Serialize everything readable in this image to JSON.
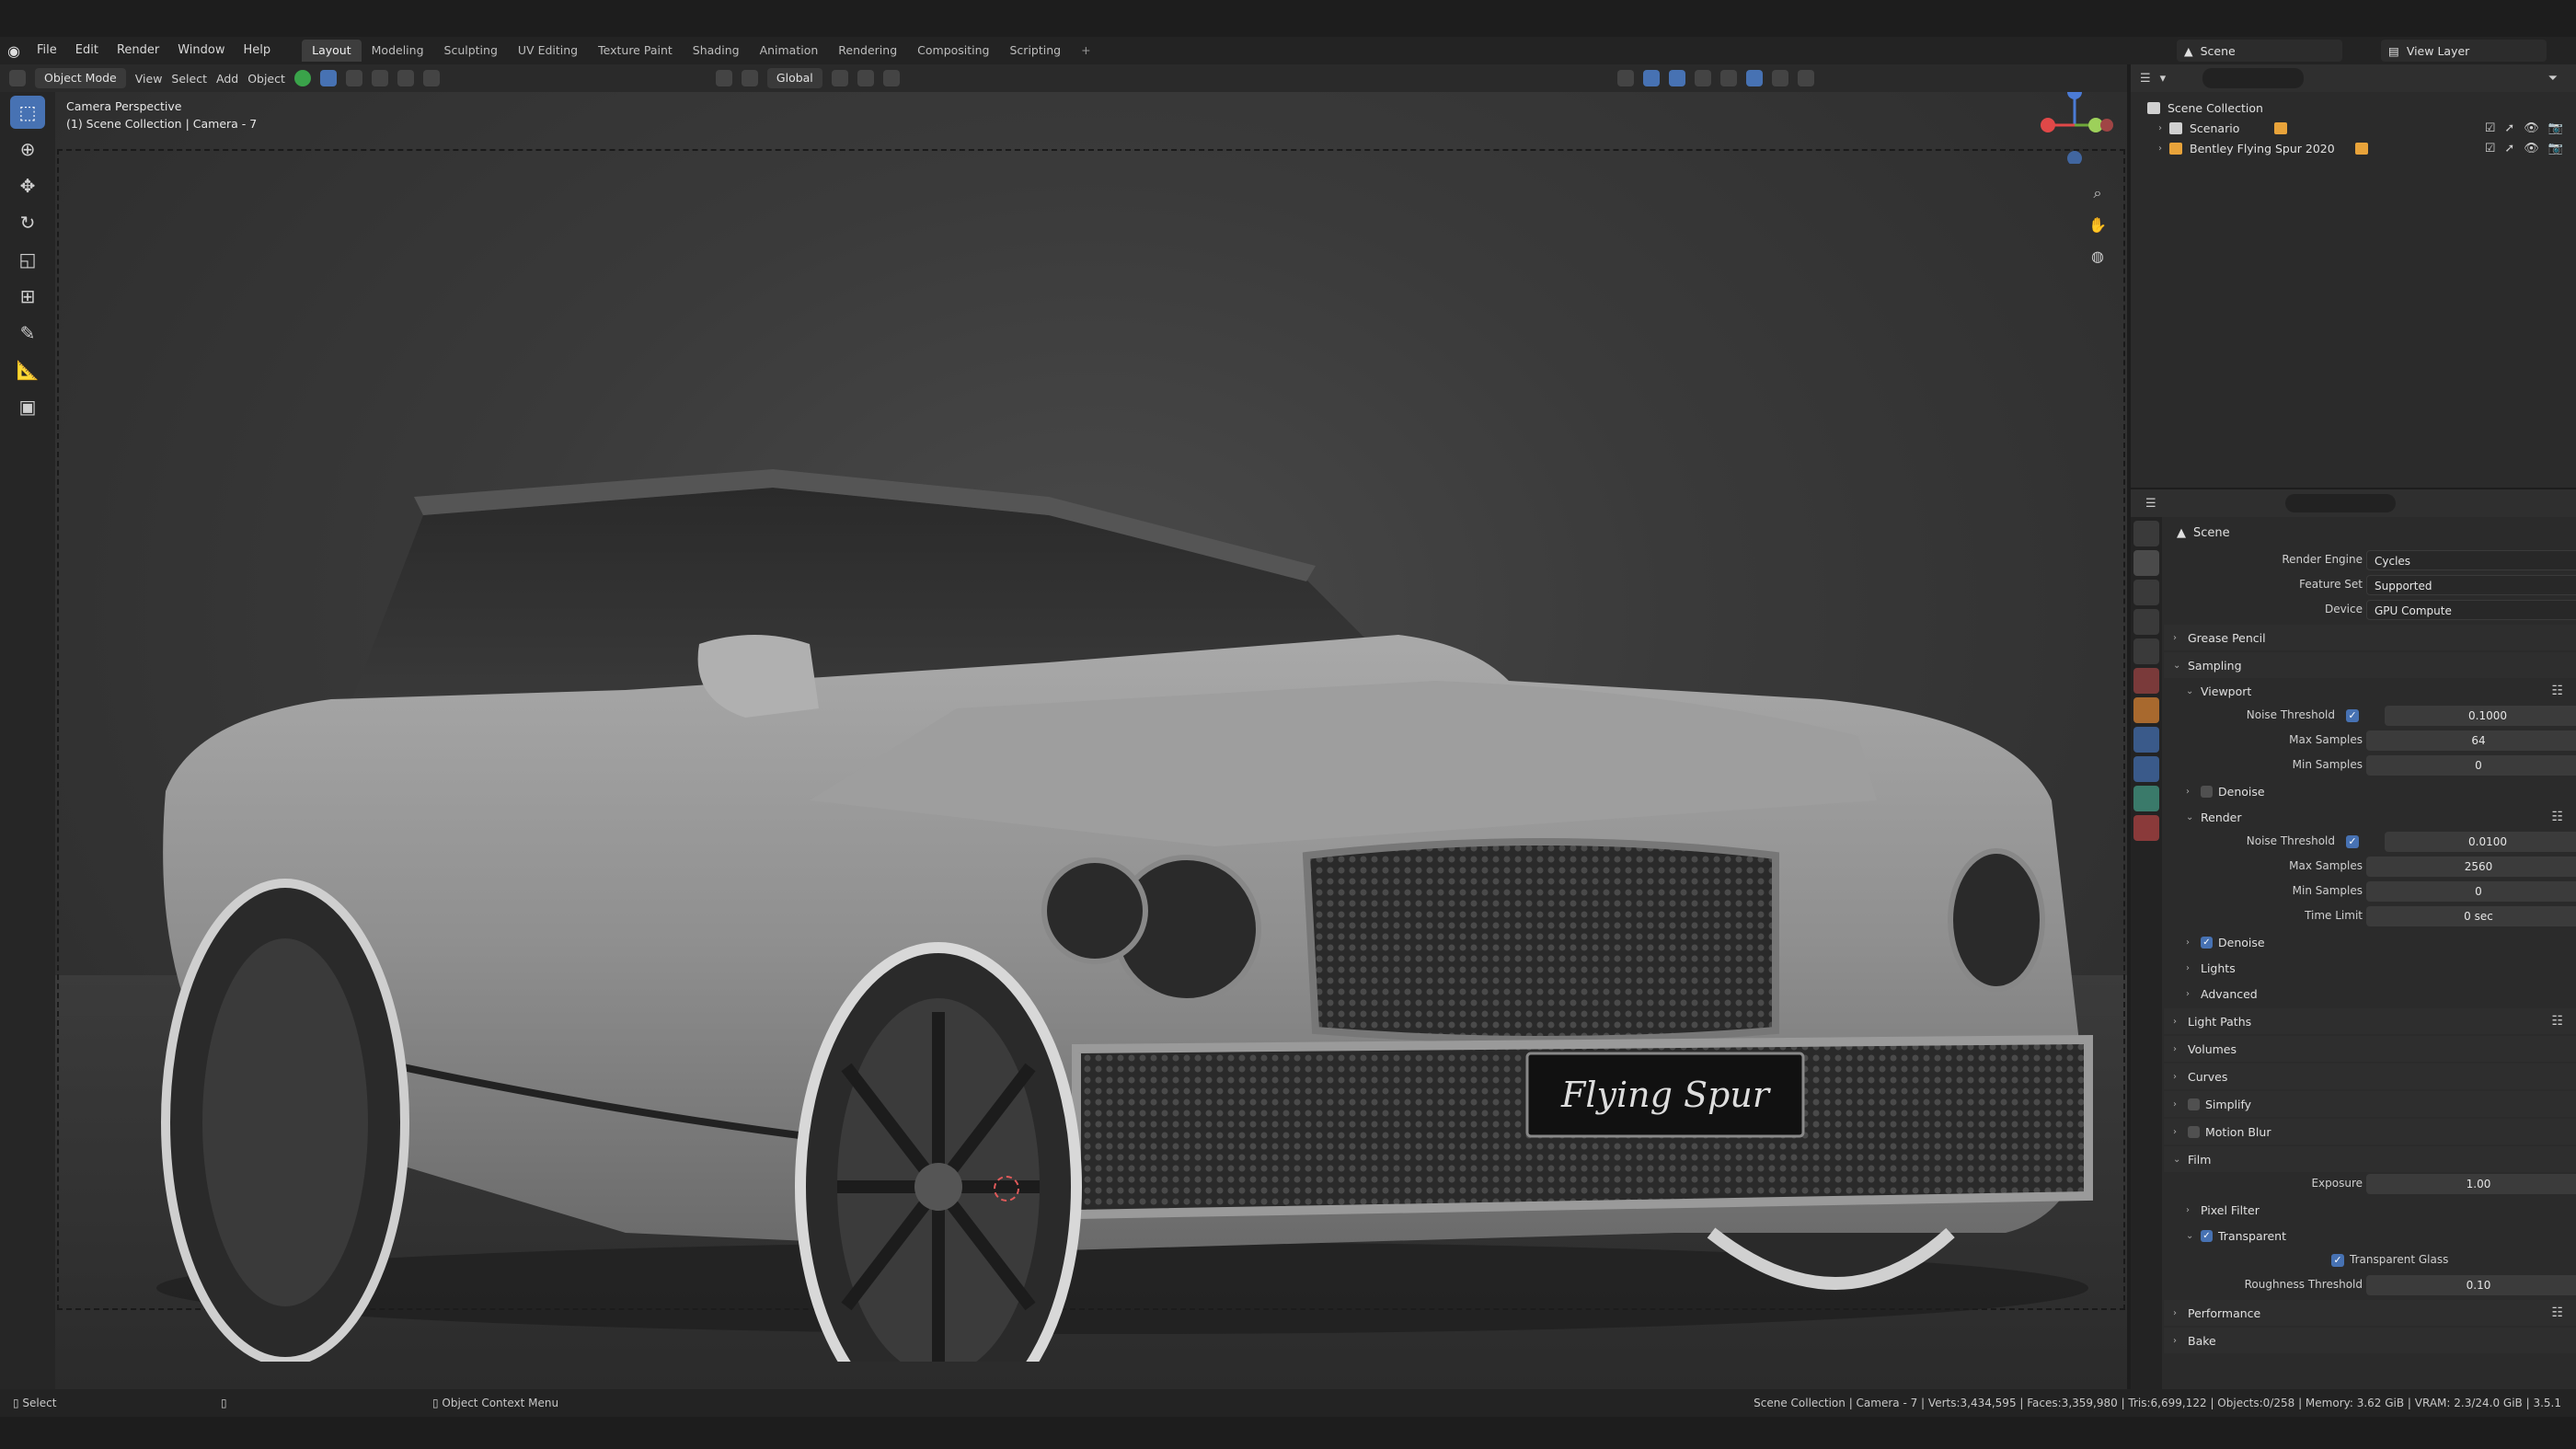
{
  "menu": [
    "File",
    "Edit",
    "Render",
    "Window",
    "Help"
  ],
  "workspaces": [
    "Layout",
    "Modeling",
    "Sculpting",
    "UV Editing",
    "Texture Paint",
    "Shading",
    "Animation",
    "Rendering",
    "Compositing",
    "Scripting",
    "+"
  ],
  "scene_name": "Scene",
  "view_layer": "View Layer",
  "viewport_header": {
    "mode": "Object Mode",
    "items": [
      "View",
      "Select",
      "Add",
      "Object"
    ],
    "orientation": "Global"
  },
  "viewport": {
    "line1": "Camera Perspective",
    "line2": "(1) Scene Collection | Camera - 7",
    "plate": "Flying Spur"
  },
  "outliner": {
    "root": "Scene Collection",
    "items": [
      "Scenario",
      "Bentley Flying Spur 2020"
    ]
  },
  "properties": {
    "title": "Scene",
    "render_engine_label": "Render Engine",
    "render_engine": "Cycles",
    "feature_set_label": "Feature Set",
    "feature_set": "Supported",
    "device_label": "Device",
    "device": "GPU Compute",
    "sections": {
      "grease_pencil": "Grease Pencil",
      "sampling": "Sampling",
      "viewport": "Viewport",
      "denoise": "Denoise",
      "render": "Render",
      "lights": "Lights",
      "advanced": "Advanced",
      "light_paths": "Light Paths",
      "volumes": "Volumes",
      "curves": "Curves",
      "simplify": "Simplify",
      "motion_blur": "Motion Blur",
      "film": "Film",
      "pixel_filter": "Pixel Filter",
      "transparent": "Transparent",
      "performance": "Performance",
      "bake": "Bake"
    },
    "labels": {
      "noise_threshold": "Noise Threshold",
      "max_samples": "Max Samples",
      "min_samples": "Min Samples",
      "time_limit": "Time Limit",
      "exposure": "Exposure",
      "transparent_glass": "Transparent Glass",
      "roughness_threshold": "Roughness Threshold"
    },
    "viewport_values": {
      "noise_threshold": "0.1000",
      "max_samples": "64",
      "min_samples": "0"
    },
    "render_values": {
      "noise_threshold": "0.0100",
      "max_samples": "2560",
      "min_samples": "0",
      "time_limit": "0 sec"
    },
    "film_values": {
      "exposure": "1.00",
      "roughness_threshold": "0.10"
    }
  },
  "status": {
    "left": "Select",
    "mid": "Object Context Menu",
    "right": "Scene Collection | Camera - 7 | Verts:3,434,595 | Faces:3,359,980 | Tris:6,699,122 | Objects:0/258 | Memory: 3.62 GiB | VRAM: 2.3/24.0 GiB | 3.5.1"
  },
  "colors": {
    "accent": "#4772b3",
    "bg": "#1d1d1d",
    "panel": "#2b2b2b"
  }
}
